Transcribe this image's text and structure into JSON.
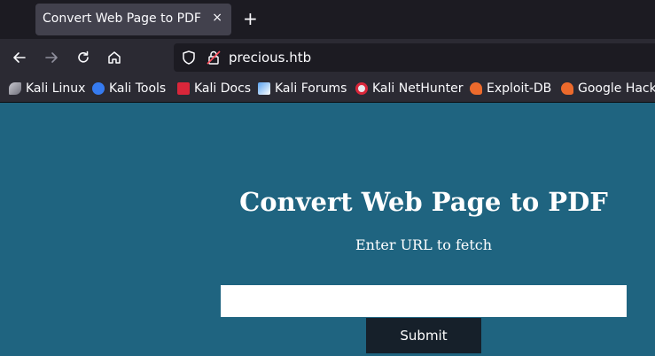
{
  "tab": {
    "title": "Convert Web Page to PDF",
    "close_glyph": "×",
    "new_tab_glyph": "+"
  },
  "nav": {
    "back_icon": "arrow-left-icon",
    "forward_icon": "arrow-right-icon",
    "reload_icon": "reload-icon",
    "home_icon": "home-icon",
    "url": "precious.htb"
  },
  "bookmarks": [
    {
      "label": "Kali Linux",
      "icon": "kali-dragon-icon"
    },
    {
      "label": "Kali Tools",
      "icon": "kali-tools-icon"
    },
    {
      "label": "Kali Docs",
      "icon": "kali-docs-icon"
    },
    {
      "label": "Kali Forums",
      "icon": "kali-forums-icon"
    },
    {
      "label": "Kali NetHunter",
      "icon": "kali-nethunter-icon"
    },
    {
      "label": "Exploit-DB",
      "icon": "exploit-db-icon"
    },
    {
      "label": "Google Hacki",
      "icon": "ghdb-icon"
    }
  ],
  "page": {
    "heading": "Convert Web Page to PDF",
    "subheading": "Enter URL to fetch",
    "url_input_value": "",
    "submit_label": "Submit"
  },
  "colors": {
    "page_background": "#1f6480",
    "submit_background": "#16202a",
    "browser_chrome": "#2b2a33"
  }
}
